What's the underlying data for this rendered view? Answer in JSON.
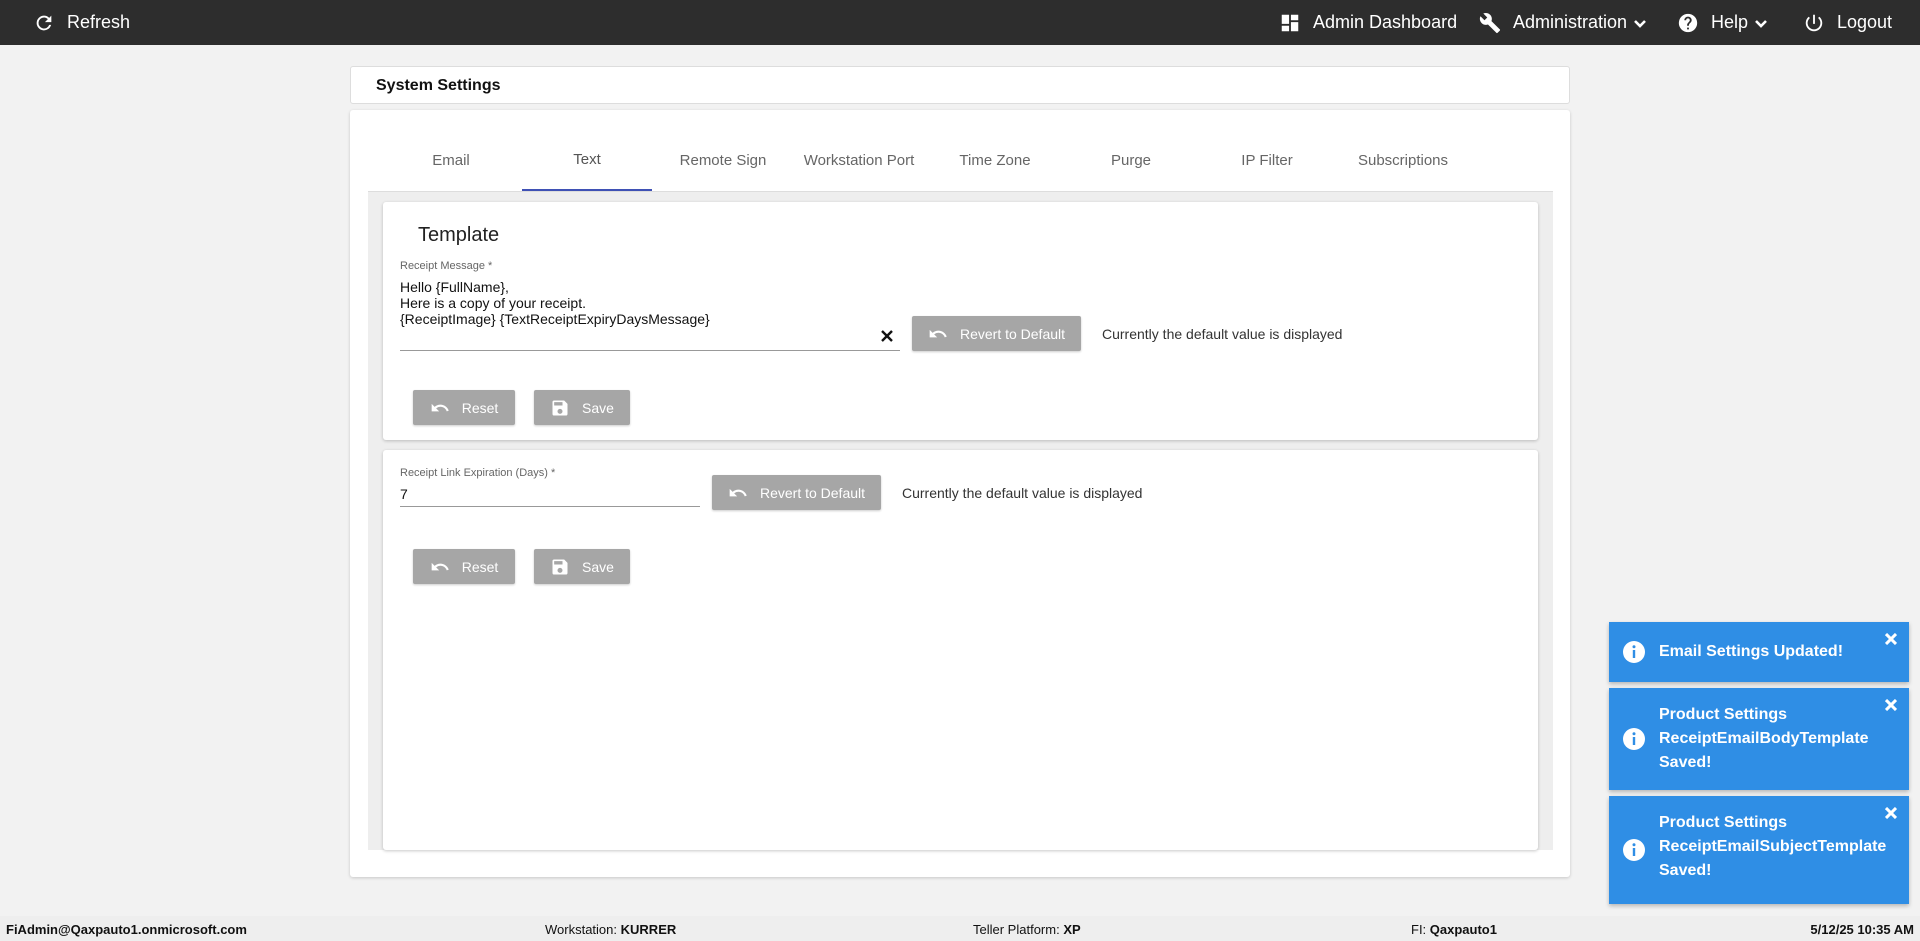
{
  "topbar": {
    "refresh_label": "Refresh",
    "admin_dashboard_label": "Admin Dashboard",
    "administration_label": "Administration",
    "help_label": "Help",
    "logout_label": "Logout"
  },
  "header": {
    "title": "System Settings"
  },
  "tabs": [
    {
      "label": "Email",
      "active": false
    },
    {
      "label": "Text",
      "active": true
    },
    {
      "label": "Remote Sign",
      "active": false
    },
    {
      "label": "Workstation Port",
      "active": false
    },
    {
      "label": "Time Zone",
      "active": false
    },
    {
      "label": "Purge",
      "active": false
    },
    {
      "label": "IP Filter",
      "active": false
    },
    {
      "label": "Subscriptions",
      "active": false
    }
  ],
  "template_panel": {
    "title": "Template",
    "receipt_message": {
      "label": "Receipt Message *",
      "value": "Hello {FullName},\nHere is a copy of your receipt.\n{ReceiptImage} {TextReceiptExpiryDaysMessage}"
    },
    "revert_label": "Revert to Default",
    "status_text": "Currently the default value is displayed",
    "reset_label": "Reset",
    "save_label": "Save"
  },
  "expiration_panel": {
    "field": {
      "label": "Receipt Link Expiration (Days) *",
      "value": "7"
    },
    "revert_label": "Revert to Default",
    "status_text": "Currently the default value is displayed",
    "reset_label": "Reset",
    "save_label": "Save"
  },
  "toasts": [
    {
      "message": "Email Settings Updated!"
    },
    {
      "message": "Product Settings ReceiptEmailBodyTemplate Saved!"
    },
    {
      "message": "Product Settings ReceiptEmailSubjectTemplate Saved!"
    }
  ],
  "footer": {
    "user": "FiAdmin@Qaxpauto1.onmicrosoft.com",
    "workstation_label": "Workstation:",
    "workstation_value": "KURRER",
    "teller_platform_label": "Teller Platform:",
    "teller_platform_value": "XP",
    "fi_label": "FI:",
    "fi_value": "Qaxpauto1",
    "datetime": "5/12/25 10:35 AM"
  },
  "colors": {
    "topbar_bg": "#2d2d2d",
    "active_tab_underline": "#3f51b5",
    "disabled_button_bg": "#a6a6a6",
    "toast_bg": "#2f8ee5"
  }
}
